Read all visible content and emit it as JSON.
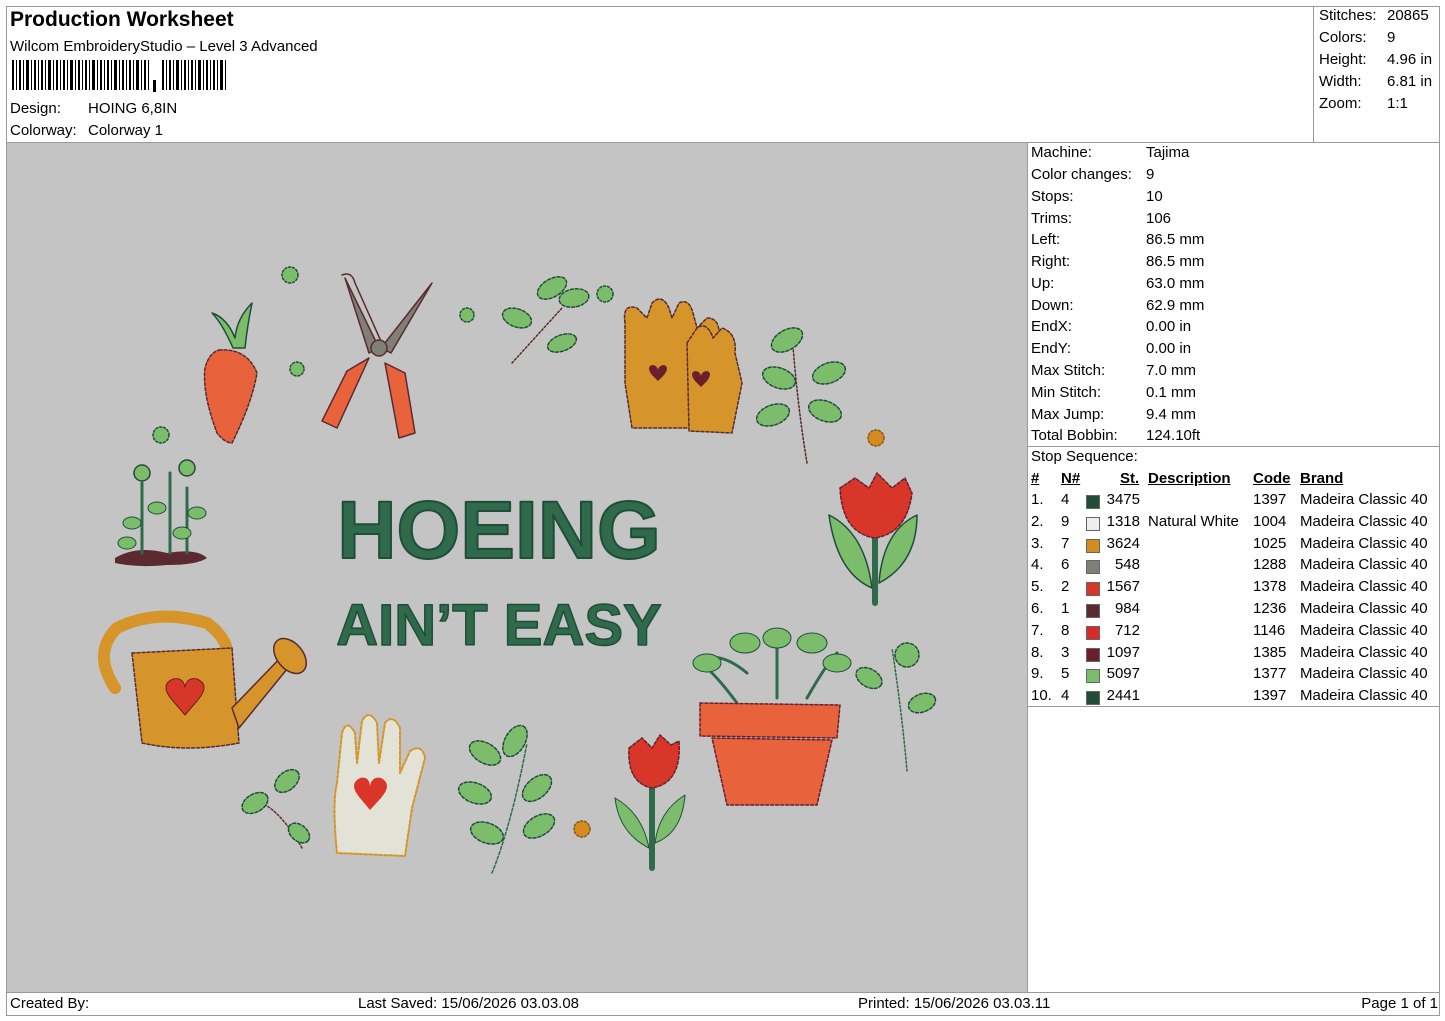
{
  "header": {
    "title": "Production Worksheet",
    "software": "Wilcom EmbroideryStudio – Level 3 Advanced",
    "design_label": "Design:",
    "design_value": "HOING 6,8IN",
    "colorway_label": "Colorway:",
    "colorway_value": "Colorway 1"
  },
  "summary": [
    {
      "label": "Stitches:",
      "value": "20865"
    },
    {
      "label": "Colors:",
      "value": "9"
    },
    {
      "label": "Height:",
      "value": "4.96 in"
    },
    {
      "label": "Width:",
      "value": "6.81 in"
    },
    {
      "label": "Zoom:",
      "value": "1:1"
    }
  ],
  "machine_info": [
    {
      "label": "Machine:",
      "value": "Tajima"
    },
    {
      "label": "Color changes:",
      "value": "9"
    },
    {
      "label": "Stops:",
      "value": "10"
    },
    {
      "label": "Trims:",
      "value": "106"
    },
    {
      "label": "Left:",
      "value": "86.5 mm"
    },
    {
      "label": "Right:",
      "value": "86.5 mm"
    },
    {
      "label": "Up:",
      "value": "63.0 mm"
    },
    {
      "label": "Down:",
      "value": "62.9 mm"
    },
    {
      "label": "EndX:",
      "value": "0.00 in"
    },
    {
      "label": "EndY:",
      "value": "0.00 in"
    },
    {
      "label": "Max Stitch:",
      "value": "7.0 mm"
    },
    {
      "label": "Min Stitch:",
      "value": "0.1 mm"
    },
    {
      "label": "Max Jump:",
      "value": "9.4 mm"
    },
    {
      "label": "Total Bobbin:",
      "value": "124.10ft"
    }
  ],
  "stop_sequence": {
    "heading": "Stop Sequence:",
    "columns": {
      "num": "#",
      "needle": "N#",
      "st": "St.",
      "desc": "Description",
      "code": "Code",
      "brand": "Brand"
    },
    "rows": [
      {
        "num": "1.",
        "needle": "4",
        "color": "#1f4d3a",
        "st": "3475",
        "desc": "",
        "code": "1397",
        "brand": "Madeira Classic 40"
      },
      {
        "num": "2.",
        "needle": "9",
        "color": "#eeeeee",
        "st": "1318",
        "desc": "Natural White",
        "code": "1004",
        "brand": "Madeira Classic 40"
      },
      {
        "num": "3.",
        "needle": "7",
        "color": "#d58a22",
        "st": "3624",
        "desc": "",
        "code": "1025",
        "brand": "Madeira Classic 40"
      },
      {
        "num": "4.",
        "needle": "6",
        "color": "#808077",
        "st": "548",
        "desc": "",
        "code": "1288",
        "brand": "Madeira Classic 40"
      },
      {
        "num": "5.",
        "needle": "2",
        "color": "#d9362a",
        "st": "1567",
        "desc": "",
        "code": "1378",
        "brand": "Madeira Classic 40"
      },
      {
        "num": "6.",
        "needle": "1",
        "color": "#5a2a2f",
        "st": "984",
        "desc": "",
        "code": "1236",
        "brand": "Madeira Classic 40"
      },
      {
        "num": "7.",
        "needle": "8",
        "color": "#d92a2a",
        "st": "712",
        "desc": "",
        "code": "1146",
        "brand": "Madeira Classic 40"
      },
      {
        "num": "8.",
        "needle": "3",
        "color": "#6b1f2c",
        "st": "1097",
        "desc": "",
        "code": "1385",
        "brand": "Madeira Classic 40"
      },
      {
        "num": "9.",
        "needle": "5",
        "color": "#7cbd6b",
        "st": "5097",
        "desc": "",
        "code": "1377",
        "brand": "Madeira Classic 40"
      },
      {
        "num": "10.",
        "needle": "4",
        "color": "#1f4d3a",
        "st": "2441",
        "desc": "",
        "code": "1397",
        "brand": "Madeira Classic 40"
      }
    ]
  },
  "design_text": {
    "line1": "HOEING",
    "line2": "AIN’T EASY"
  },
  "footer": {
    "created_by": "Created By:",
    "last_saved": "Last Saved: 15/06/2026 03.03.08",
    "printed": "Printed: 15/06/2026 03.03.11",
    "page": "Page 1 of 1"
  }
}
